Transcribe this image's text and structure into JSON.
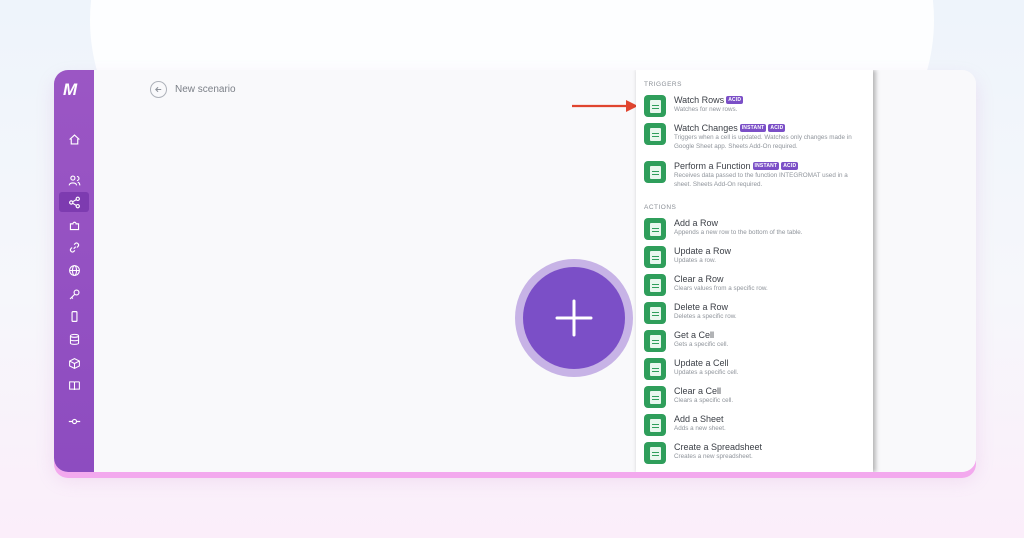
{
  "header": {
    "back_icon": "arrow-left-icon",
    "title": "New scenario"
  },
  "sidebar": {
    "logo": "M",
    "icons": [
      "home-icon",
      "users-icon",
      "share-icon",
      "puzzle-icon",
      "link-icon",
      "globe-icon",
      "key-icon",
      "phone-icon",
      "database-icon",
      "cube-icon",
      "book-icon",
      "commit-icon"
    ],
    "active_index": 2
  },
  "canvas": {
    "add_icon": "plus-icon"
  },
  "panel": {
    "triggers_label": "TRIGGERS",
    "actions_label": "ACTIONS",
    "triggers": [
      {
        "title": "Watch Rows",
        "badges": [
          "ACID"
        ],
        "desc": "Watches for new rows."
      },
      {
        "title": "Watch Changes",
        "badges": [
          "INSTANT",
          "ACID"
        ],
        "desc": "Triggers when a cell is updated. Watches only changes made in Google Sheet app. Sheets Add-On required."
      },
      {
        "title": "Perform a Function",
        "badges": [
          "INSTANT",
          "ACID"
        ],
        "desc": "Receives data passed to the function INTEGROMAT used in a sheet. Sheets Add-On required."
      }
    ],
    "actions": [
      {
        "title": "Add a Row",
        "desc": "Appends a new row to the bottom of the table."
      },
      {
        "title": "Update a Row",
        "desc": "Updates a row."
      },
      {
        "title": "Clear a Row",
        "desc": "Clears values from a specific row."
      },
      {
        "title": "Delete a Row",
        "desc": "Deletes a specific row."
      },
      {
        "title": "Get a Cell",
        "desc": "Gets a specific cell."
      },
      {
        "title": "Update a Cell",
        "desc": "Updates a specific cell."
      },
      {
        "title": "Clear a Cell",
        "desc": "Clears a specific cell."
      },
      {
        "title": "Add a Sheet",
        "desc": "Adds a new sheet."
      },
      {
        "title": "Create a Spreadsheet",
        "desc": "Creates a new spreadsheet."
      }
    ]
  },
  "colors": {
    "brand": "#9b56c4",
    "accent": "#7b4fc7",
    "sheets_green": "#2f9e5b",
    "arrow_red": "#e0452f",
    "frame_pink": "#f3a9ee"
  }
}
